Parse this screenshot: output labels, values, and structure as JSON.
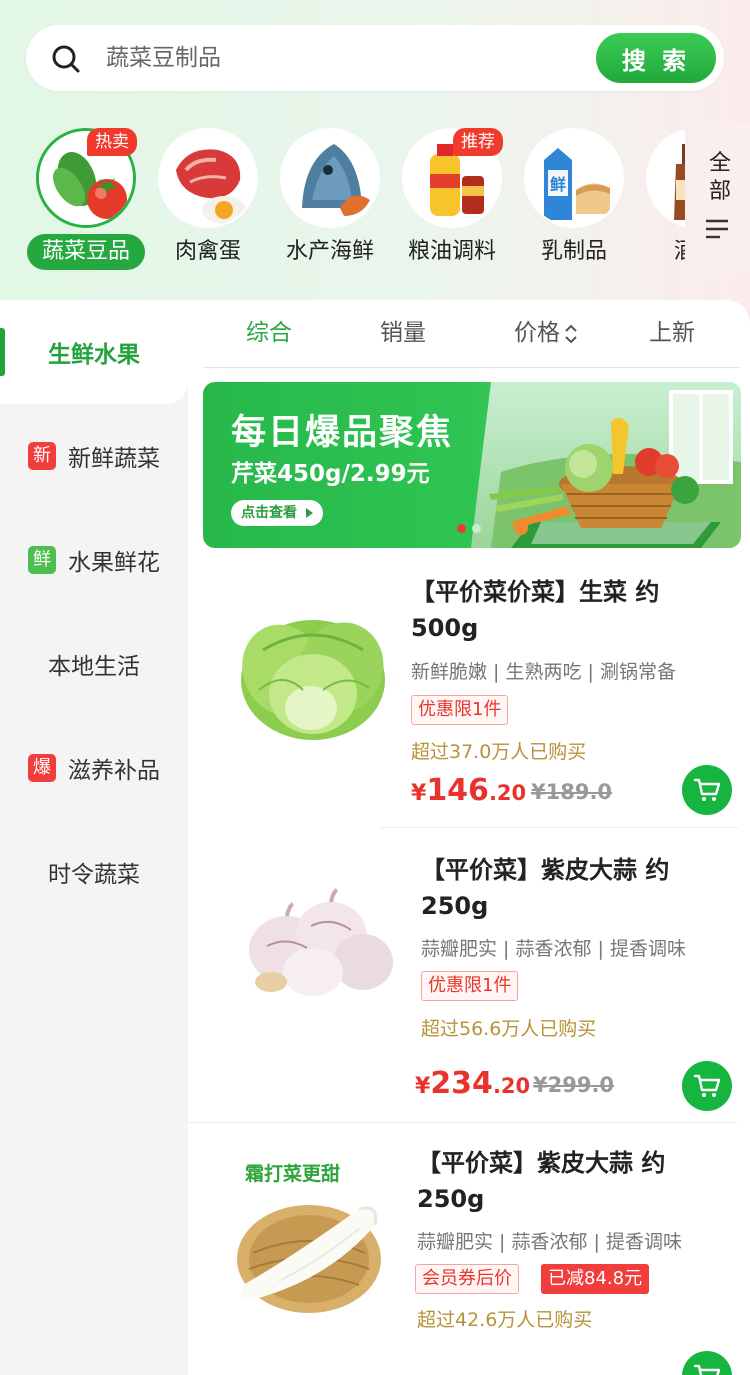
{
  "search": {
    "placeholder": "蔬菜豆制品",
    "button_label": "搜 索"
  },
  "categories": [
    {
      "label": "蔬菜豆品",
      "badge": "热卖",
      "icon": "vegetables-icon",
      "active": true
    },
    {
      "label": "肉禽蛋",
      "badge": "",
      "icon": "meat-egg-icon",
      "active": false
    },
    {
      "label": "水产海鲜",
      "badge": "",
      "icon": "fish-icon",
      "active": false
    },
    {
      "label": "粮油调料",
      "badge": "推荐",
      "icon": "oil-icon",
      "active": false
    },
    {
      "label": "乳制品",
      "badge": "",
      "icon": "milk-icon",
      "active": false
    },
    {
      "label": "酒水",
      "badge": "",
      "icon": "wine-icon",
      "active": false
    }
  ],
  "category_all": {
    "label": "全部",
    "icon": "menu-icon"
  },
  "sidebar": {
    "items": [
      {
        "label": "生鲜水果",
        "tag": "",
        "active": true
      },
      {
        "label": "新鲜蔬菜",
        "tag": "新"
      },
      {
        "label": "水果鲜花",
        "tag": "鲜"
      },
      {
        "label": "本地生活",
        "tag": ""
      },
      {
        "label": "滋养补品",
        "tag": "爆"
      },
      {
        "label": "时令蔬菜",
        "tag": ""
      }
    ]
  },
  "sort": {
    "items": [
      {
        "label": "综合",
        "active": true
      },
      {
        "label": "销量"
      },
      {
        "label": "价格"
      },
      {
        "label": "上新"
      }
    ]
  },
  "banner": {
    "title": "每日爆品聚焦",
    "subtitle": "芹菜450g/2.99元",
    "button_label": "点击查看"
  },
  "products": [
    {
      "title": "【平价菜价菜】生菜 约500g",
      "title_line1": "【平价菜价菜】生菜 约",
      "title_line2": "500g",
      "desc": "新鲜脆嫩 | 生熟两吃 | 涮锅常备",
      "tags": [
        "优惠限1件"
      ],
      "sales": "超过37.0万人已购买",
      "price_currency": "¥",
      "price_int": "146",
      "price_dec": ".20",
      "old_price": "¥189.0",
      "image": "lettuce-image"
    },
    {
      "title": "【平价菜】紫皮大蒜 约250g",
      "title_line1": "【平价菜】紫皮大蒜 约",
      "title_line2": "250g",
      "desc": "蒜瓣肥实 | 蒜香浓郁 | 提香调味",
      "tags": [
        "优惠限1件"
      ],
      "sales": "超过56.6万人已购买",
      "price_currency": "¥",
      "price_int": "234",
      "price_dec": ".20",
      "old_price": "¥299.0",
      "image": "garlic-image"
    },
    {
      "title": "【平价菜】紫皮大蒜 约250g",
      "title_line1": "【平价菜】紫皮大蒜 约",
      "title_line2": "250g",
      "desc": "蒜瓣肥实 | 蒜香浓郁 | 提香调味",
      "tags": [
        "会员券后价",
        "已减84.8元"
      ],
      "sales": "超过42.6万人已购买",
      "image": "radish-image",
      "image_text": "霜打菜更甜"
    }
  ],
  "colors": {
    "accent_green": "#22a43d",
    "price_red": "#e8332c",
    "badge_red": "#f03b2c"
  }
}
